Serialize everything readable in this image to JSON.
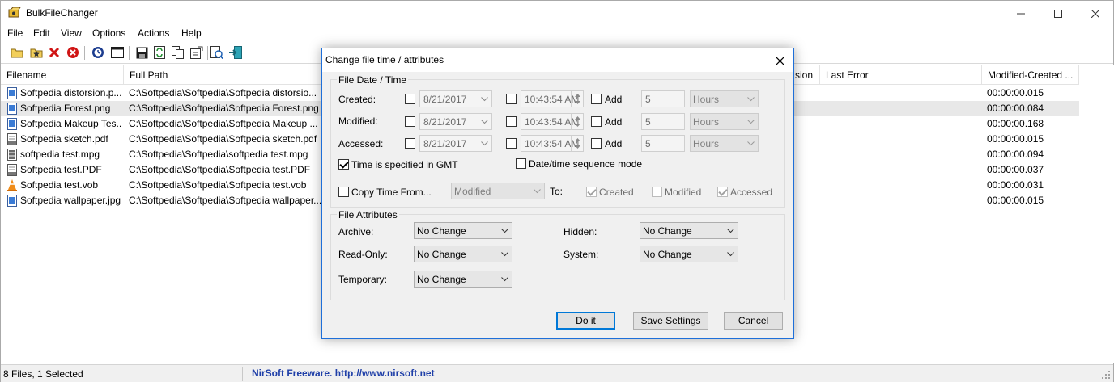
{
  "app": {
    "title": "BulkFileChanger"
  },
  "menu": [
    "File",
    "Edit",
    "View",
    "Options",
    "Actions",
    "Help"
  ],
  "toolbar": {
    "icons": [
      "open-folder-icon",
      "add-files-icon",
      "remove-icon",
      "delete-icon",
      "properties-icon",
      "window-icon",
      "save-icon",
      "refresh-icon",
      "copy-icon",
      "change-time-icon",
      "run-icon",
      "exit-icon"
    ]
  },
  "list": {
    "columns": [
      "Filename",
      "Full Path",
      "sion",
      "Last Error",
      "Modified-Created ..."
    ],
    "rows": [
      {
        "filename": "Softpedia distorsion.p...",
        "path": "C:\\Softpedia\\Softpedia\\Softpedia distorsio...",
        "diff": "00:00:00.015",
        "icon": "image-file-icon",
        "selected": false
      },
      {
        "filename": "Softpedia Forest.png",
        "path": "C:\\Softpedia\\Softpedia\\Softpedia Forest.png",
        "diff": "00:00:00.084",
        "icon": "image-file-icon",
        "selected": true
      },
      {
        "filename": "Softpedia Makeup Tes...",
        "path": "C:\\Softpedia\\Softpedia\\Softpedia Makeup ...",
        "diff": "00:00:00.168",
        "icon": "image-file-icon",
        "selected": false
      },
      {
        "filename": "Softpedia sketch.pdf",
        "path": "C:\\Softpedia\\Softpedia\\Softpedia sketch.pdf",
        "diff": "00:00:00.015",
        "icon": "pdf-file-icon",
        "selected": false
      },
      {
        "filename": "softpedia test.mpg",
        "path": "C:\\Softpedia\\Softpedia\\softpedia test.mpg",
        "diff": "00:00:00.094",
        "icon": "video-file-icon",
        "selected": false
      },
      {
        "filename": "Softpedia test.PDF",
        "path": "C:\\Softpedia\\Softpedia\\Softpedia test.PDF",
        "diff": "00:00:00.037",
        "icon": "pdf-file-icon",
        "selected": false
      },
      {
        "filename": "Softpedia test.vob",
        "path": "C:\\Softpedia\\Softpedia\\Softpedia test.vob",
        "diff": "00:00:00.031",
        "icon": "vlc-cone-icon",
        "selected": false
      },
      {
        "filename": "Softpedia wallpaper.jpg",
        "path": "C:\\Softpedia\\Softpedia\\Softpedia wallpaper...",
        "diff": "00:00:00.015",
        "icon": "image-file-icon",
        "selected": false
      }
    ]
  },
  "status": {
    "left": "8 Files, 1 Selected",
    "right": "NirSoft Freeware.  http://www.nirsoft.net"
  },
  "dialog": {
    "title": "Change file time / attributes",
    "datetime_group": "File Date / Time",
    "created_label": "Created:",
    "modified_label": "Modified:",
    "accessed_label": "Accessed:",
    "date_value": "8/21/2017",
    "time_value": "10:43:54 AM",
    "add_label": "Add",
    "add_amount": "5",
    "unit_value": "Hours",
    "gmt_label": "Time is specified in GMT",
    "gmt_checked": true,
    "sequence_label": "Date/time sequence mode",
    "copy_label": "Copy Time From...",
    "copy_source": "Modified",
    "to_label": "To:",
    "to_created": "Created",
    "to_modified": "Modified",
    "to_accessed": "Accessed",
    "attr_group": "File Attributes",
    "archive_label": "Archive:",
    "readonly_label": "Read-Only:",
    "temporary_label": "Temporary:",
    "hidden_label": "Hidden:",
    "system_label": "System:",
    "attr_value": "No Change",
    "doit_label": "Do it",
    "save_label": "Save Settings",
    "cancel_label": "Cancel"
  },
  "colors": {
    "dialog_border": "#1e6fd9",
    "status_link": "#1f3fa8",
    "selected_row": "#e8e8e8"
  }
}
